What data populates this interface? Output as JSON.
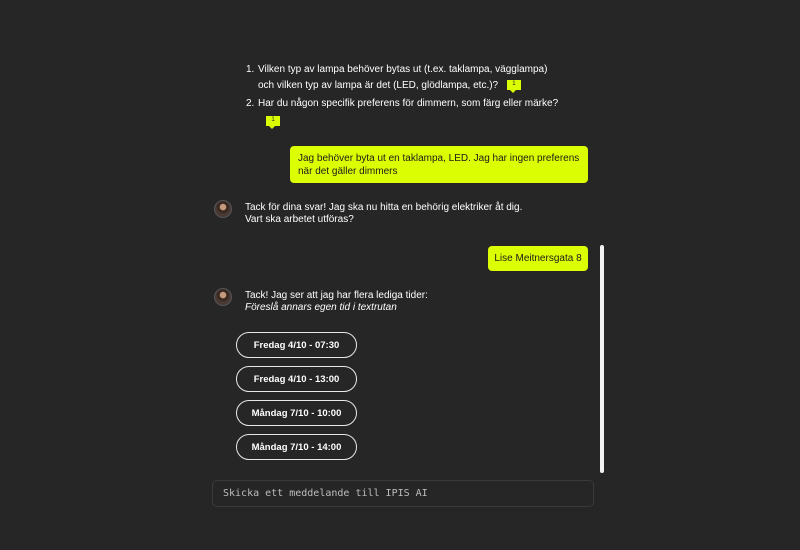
{
  "questions": [
    {
      "number": "1.",
      "line1": "Vilken typ av lampa behöver bytas ut (t.ex. taklampa, vägglampa)",
      "line2": "och vilken typ av lampa är det (LED, glödlampa, etc.)?",
      "cite": "1"
    },
    {
      "number": "2.",
      "line1": "Har du någon specifik preferens för dimmern, som färg eller märke?",
      "cite": "1"
    }
  ],
  "messages": [
    {
      "role": "user",
      "text": "Jag behöver byta ut en taklampa, LED. Jag har ingen preferens när det gäller dimmers"
    },
    {
      "role": "assistant",
      "line1": "Tack för dina svar! Jag ska nu hitta en behörig elektriker åt dig.",
      "line2": "Vart ska arbetet utföras?"
    },
    {
      "role": "user",
      "text": "Lise Meitnersgata 8"
    },
    {
      "role": "assistant",
      "line1": "Tack! Jag ser att jag har flera lediga tider:",
      "line2": "Föreslå annars egen tid i textrutan"
    }
  ],
  "time_slots": [
    "Fredag 4/10 - 07:30",
    "Fredag 4/10 - 13:00",
    "Måndag 7/10 - 10:00",
    "Måndag 7/10 - 14:00"
  ],
  "input": {
    "placeholder": "Skicka ett meddelande till IPIS AI",
    "value": ""
  },
  "colors": {
    "background": "#262626",
    "accent": "#dcfe03",
    "text": "#ffffff"
  },
  "icons": {
    "avatar": "assistant-avatar",
    "citation": "citation-badge-icon"
  }
}
